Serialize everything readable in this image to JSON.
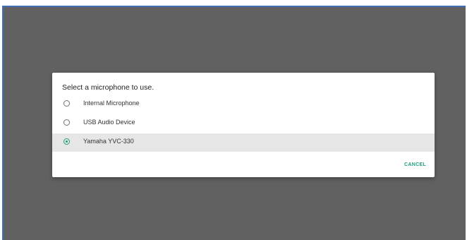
{
  "dialog": {
    "title": "Select a microphone to use.",
    "options": [
      {
        "label": "Internal Microphone",
        "selected": false
      },
      {
        "label": "USB Audio Device",
        "selected": false
      },
      {
        "label": "Yamaha YVC-330",
        "selected": true
      }
    ],
    "cancel_label": "CANCEL"
  },
  "colors": {
    "backdrop": "#616161",
    "accent": "#1e9e7e",
    "selected_row": "#e6e6e6",
    "frame_border": "#3f6fb6"
  },
  "icons": {
    "unselected": "radio-unchecked-icon",
    "selected": "radio-checked-icon"
  }
}
